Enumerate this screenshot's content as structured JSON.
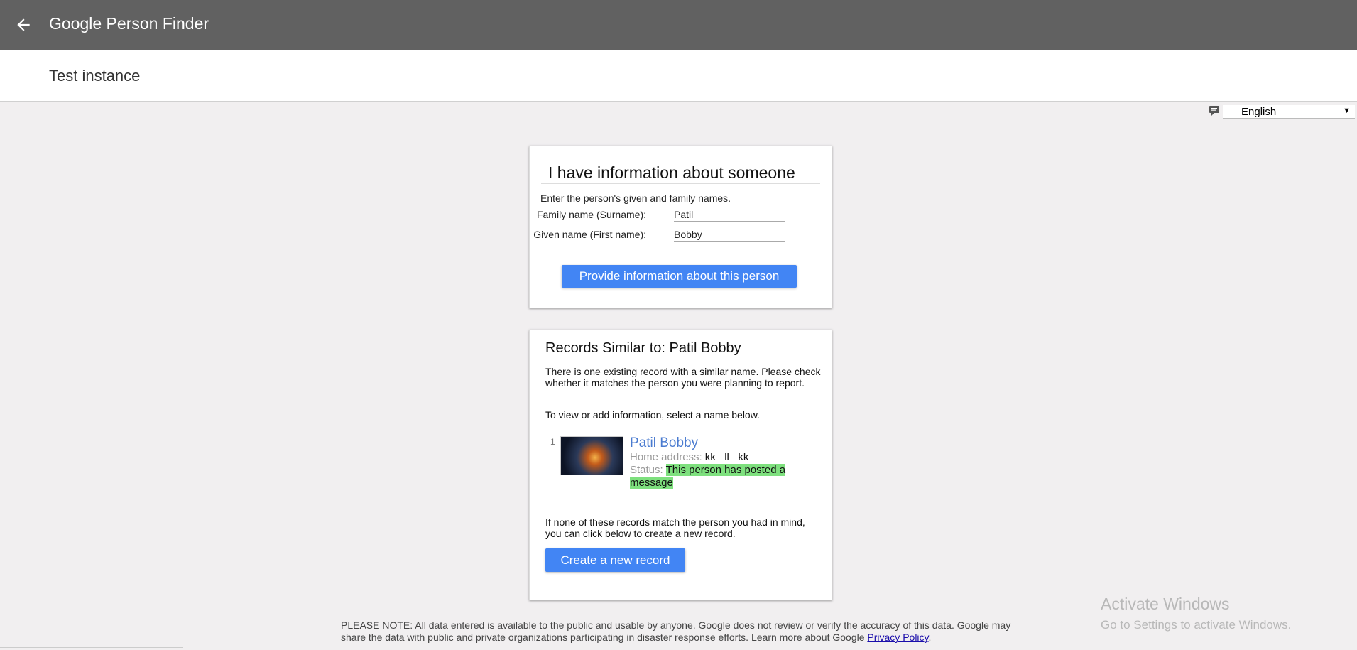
{
  "header": {
    "app_title": "Google Person Finder",
    "back_icon": "arrow-left-icon"
  },
  "subheader": {
    "instance_title": "Test instance"
  },
  "language": {
    "icon": "speech-bubble-icon",
    "selected": "English",
    "arrow": "▼"
  },
  "info_card": {
    "title": "I have information about someone",
    "intro": "Enter the person's given and family names.",
    "family_label": "Family name (Surname):",
    "family_value": "Patil",
    "given_label": "Given name (First name):",
    "given_value": "Bobby",
    "provide_button": "Provide information about this person"
  },
  "similar_card": {
    "title": "Records Similar to: Patil Bobby",
    "paragraph1": "There is one existing record with a similar name. Please check whether it matches the person you were planning to report.",
    "paragraph2": "To view or add information, select a name below.",
    "records": [
      {
        "index": "1",
        "name": "Patil Bobby",
        "address_label": "Home address:",
        "address_value": "kk   ll   kk",
        "status_label": "Status:",
        "status_value": "This person has posted a message"
      }
    ],
    "paragraph3": "If none of these records match the person you had in mind, you can click below to create a new record.",
    "create_button": "Create a new record"
  },
  "watermark": {
    "line1": "Activate Windows",
    "line2": "Go to Settings to activate Windows."
  },
  "footer": {
    "note": "PLEASE NOTE: All data entered is available to the public and usable by anyone. Google does not review or verify the accuracy of this data. Google may share the data with public and private organizations participating in disaster response efforts. Learn more about Google ",
    "link": "Privacy Policy",
    "end": "."
  },
  "colors": {
    "topbar": "#616161",
    "accent_button": "#4285f4",
    "status_highlight": "#7ee07e",
    "link": "#4a7bd0"
  }
}
